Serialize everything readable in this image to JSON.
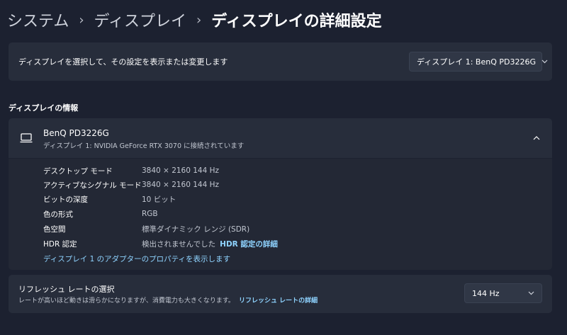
{
  "breadcrumb": {
    "items": [
      "システム",
      "ディスプレイ"
    ],
    "current": "ディスプレイの詳細設定",
    "separator": "›"
  },
  "display_select": {
    "description": "ディスプレイを選択して、その設定を表示または変更します",
    "selected": "ディスプレイ 1: BenQ PD3226G"
  },
  "section": {
    "title": "ディスプレイの情報"
  },
  "display_info": {
    "name": "BenQ PD3226G",
    "subtitle": "ディスプレイ 1: NVIDIA GeForce RTX 3070 に接続されています",
    "rows": [
      {
        "label": "デスクトップ モード",
        "value": "3840 × 2160 144 Hz"
      },
      {
        "label": "アクティブなシグナル モード",
        "value": "3840 × 2160 144 Hz"
      },
      {
        "label": "ビットの深度",
        "value": "10 ビット"
      },
      {
        "label": "色の形式",
        "value": "RGB"
      },
      {
        "label": "色空間",
        "value": "標準ダイナミック レンジ (SDR)"
      },
      {
        "label": "HDR 認定",
        "value": "検出されませんでした",
        "link": "HDR 認定の詳細"
      }
    ],
    "adapter_link": "ディスプレイ 1 のアダプターのプロパティを表示します"
  },
  "refresh": {
    "title": "リフレッシュ レートの選択",
    "description": "レートが高いほど動きは滑らかになりますが、消費電力も大きくなります。",
    "link": "リフレッシュ レートの詳細",
    "selected": "144 Hz"
  },
  "colors": {
    "background": "#1c2130",
    "card": "#272d3b",
    "link": "#8fd3ff"
  },
  "icons": {
    "display": "monitor-icon",
    "dropdown": "chevron-down-icon",
    "collapse": "chevron-up-icon"
  }
}
